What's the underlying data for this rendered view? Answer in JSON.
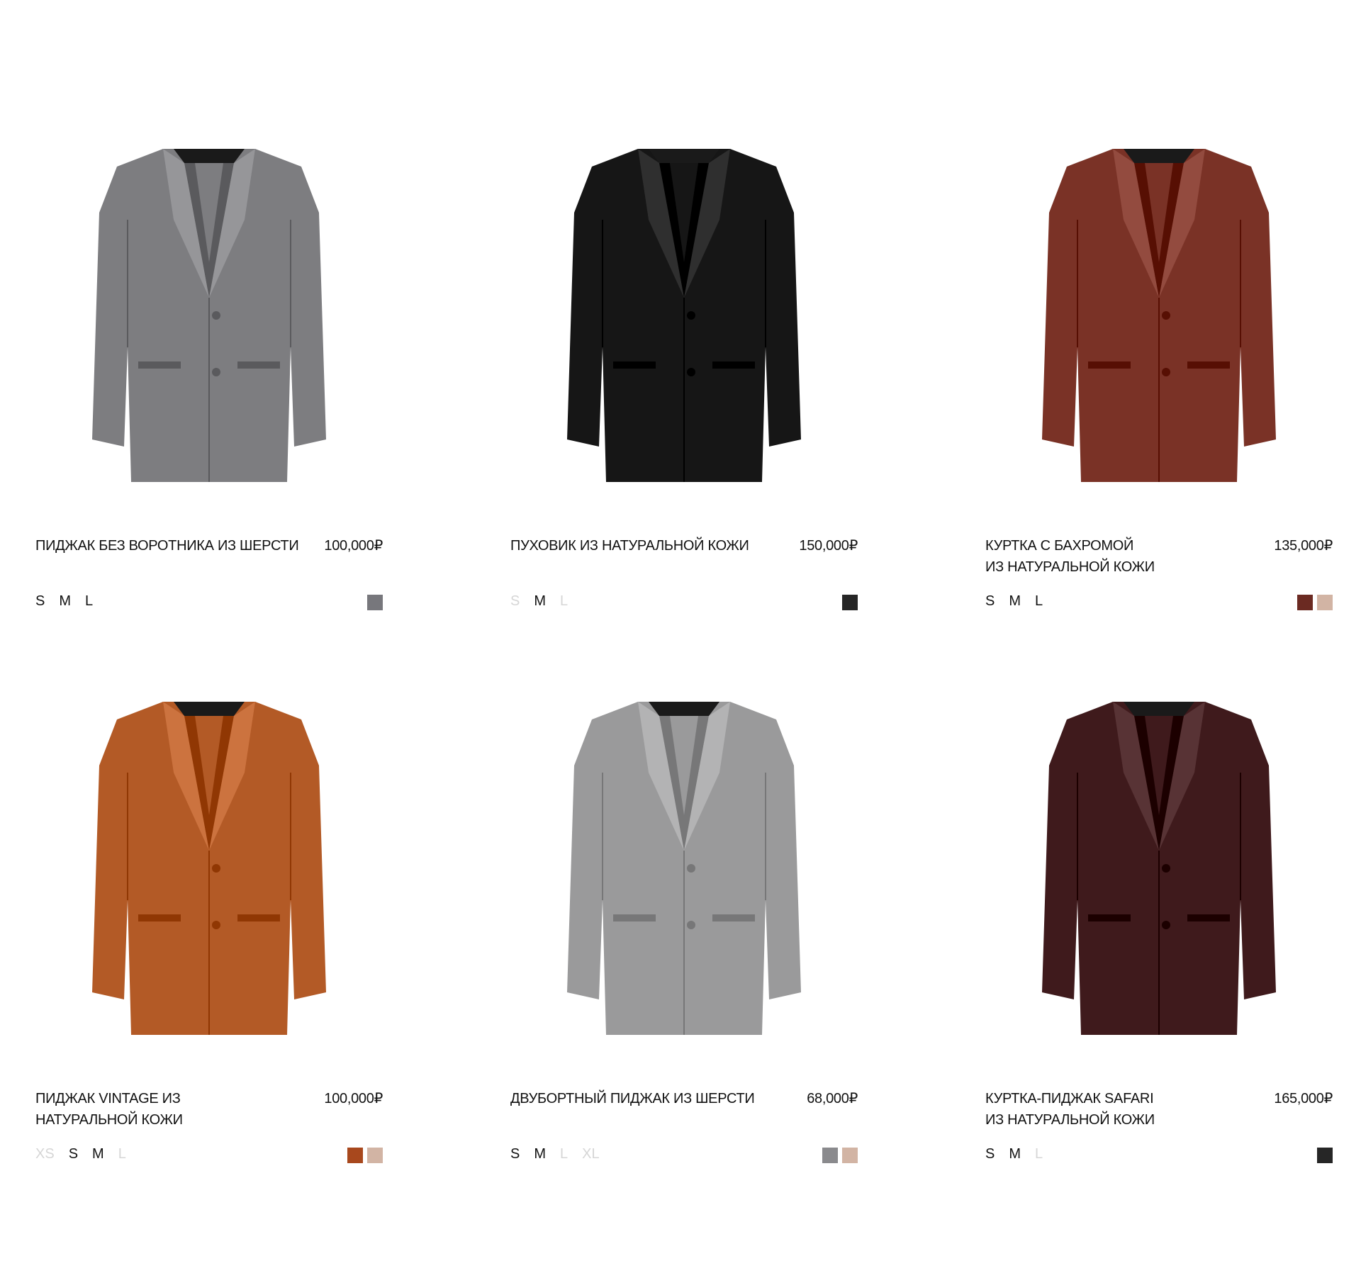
{
  "products": [
    {
      "name_lines": [
        "ПИДЖАК БЕЗ ВОРОТНИКА ИЗ ШЕРСТИ"
      ],
      "price": "100,000₽",
      "sizes": [
        {
          "label": "S",
          "available": true
        },
        {
          "label": "M",
          "available": true
        },
        {
          "label": "L",
          "available": true
        }
      ],
      "swatches": [
        "#77777c"
      ],
      "image_icon": "jacket-grey-blazer-icon",
      "body_color": "#7d7d80"
    },
    {
      "name_lines": [
        "ПУХОВИК ИЗ НАТУРАЛЬНОЙ КОЖИ"
      ],
      "price": "150,000₽",
      "sizes": [
        {
          "label": "S",
          "available": false
        },
        {
          "label": "M",
          "available": true
        },
        {
          "label": "L",
          "available": false
        }
      ],
      "swatches": [
        "#262626"
      ],
      "image_icon": "jacket-black-leather-icon",
      "body_color": "#161616"
    },
    {
      "name_lines": [
        "КУРТКА С БАХРОМОЙ",
        "ИЗ НАТУРАЛЬНОЙ КОЖИ"
      ],
      "price": "135,000₽",
      "sizes": [
        {
          "label": "S",
          "available": true
        },
        {
          "label": "M",
          "available": true
        },
        {
          "label": "L",
          "available": true
        }
      ],
      "swatches": [
        "#6b2a22",
        "#d2b4a4"
      ],
      "image_icon": "jacket-fringe-leather-icon",
      "body_color": "#7a3226"
    },
    {
      "name_lines": [
        "ПИДЖАК VINTAGE ИЗ",
        "НАТУРАЛЬНОЙ КОЖИ"
      ],
      "price": "100,000₽",
      "sizes": [
        {
          "label": "XS",
          "available": false
        },
        {
          "label": "S",
          "available": true
        },
        {
          "label": "M",
          "available": true
        },
        {
          "label": "L",
          "available": false
        }
      ],
      "swatches": [
        "#a8481d",
        "#d2b4a4"
      ],
      "image_icon": "jacket-cognac-blazer-icon",
      "body_color": "#b35a26"
    },
    {
      "name_lines": [
        "ДВУБОРТНЫЙ ПИДЖАК ИЗ ШЕРСТИ"
      ],
      "price": "68,000₽",
      "sizes": [
        {
          "label": "S",
          "available": true
        },
        {
          "label": "M",
          "available": true
        },
        {
          "label": "L",
          "available": false
        },
        {
          "label": "XL",
          "available": false
        }
      ],
      "swatches": [
        "#8a8a8d",
        "#d2b4a4"
      ],
      "image_icon": "jacket-grey-double-breasted-icon",
      "body_color": "#9a9a9b"
    },
    {
      "name_lines": [
        "КУРТКА-ПИДЖАК SAFARI",
        "ИЗ НАТУРАЛЬНОЙ КОЖИ"
      ],
      "price": "165,000₽",
      "sizes": [
        {
          "label": "S",
          "available": true
        },
        {
          "label": "M",
          "available": true
        },
        {
          "label": "L",
          "available": false
        }
      ],
      "swatches": [
        "#262626"
      ],
      "image_icon": "jacket-burgundy-safari-icon",
      "body_color": "#3f1a1c"
    }
  ]
}
